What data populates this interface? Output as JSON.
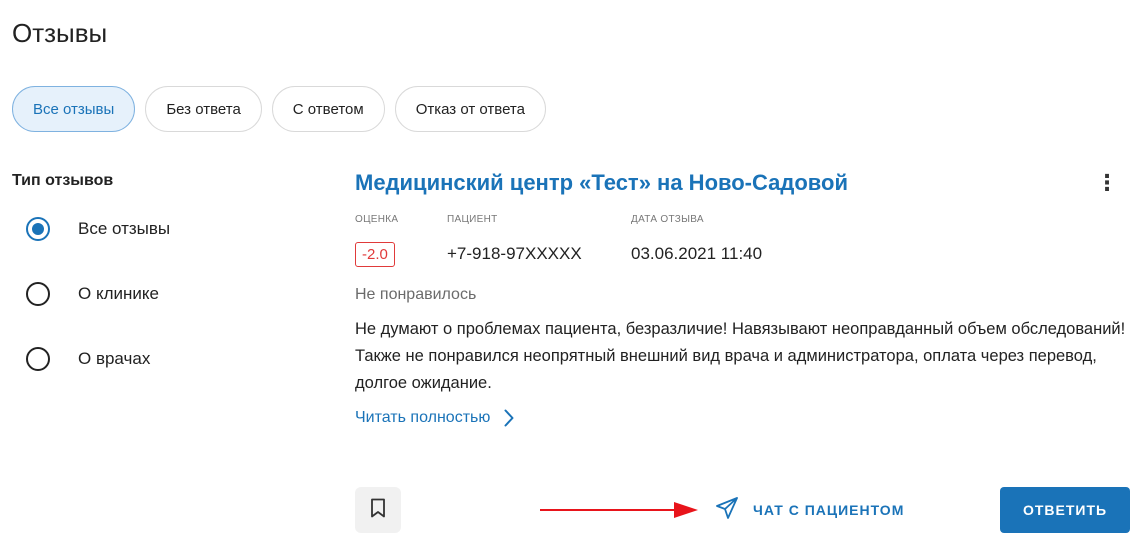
{
  "page": {
    "title": "Отзывы"
  },
  "filters": [
    {
      "label": "Все отзывы",
      "active": true
    },
    {
      "label": "Без ответа",
      "active": false
    },
    {
      "label": "С ответом",
      "active": false
    },
    {
      "label": "Отказ от ответа",
      "active": false
    }
  ],
  "sidebar": {
    "title": "Тип отзывов",
    "options": [
      {
        "label": "Все отзывы",
        "checked": true
      },
      {
        "label": "О клинике",
        "checked": false
      },
      {
        "label": "О врачах",
        "checked": false
      }
    ]
  },
  "review": {
    "clinic_name": "Медицинский центр «Тест» на Ново-Садовой",
    "headers": {
      "score": "ОЦЕНКА",
      "patient": "ПАЦИЕНТ",
      "date": "ДАТА ОТЗЫВА"
    },
    "score": "-2.0",
    "patient": "+7-918-97XXXXX",
    "date": "03.06.2021 11:40",
    "sentiment": "Не понравилось",
    "text": "Не думают о проблемах пациента, безразличие! Навязывают неоправданный объем обследований! Также не понравился неопрятный внешний вид врача и администратора, оплата через перевод, долгое ожидание.",
    "read_more": "Читать полностью"
  },
  "actions": {
    "chat_label": "ЧАТ С ПАЦИЕНТОМ",
    "reply_label": "ОТВЕТИТЬ"
  },
  "colors": {
    "accent": "#1a73b8",
    "score_negative": "#e03a3a",
    "annotation_arrow": "#e8141b"
  },
  "icons": [
    "kebab-menu-icon",
    "chevron-right-icon",
    "bookmark-icon",
    "send-icon",
    "arrow-right-icon"
  ]
}
